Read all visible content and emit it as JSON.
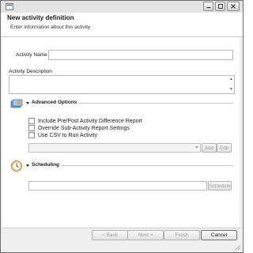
{
  "header": {
    "title": "New activity definition",
    "subtitle": "Enter information about this activity"
  },
  "form": {
    "activity_name_label": "Activity Name :",
    "activity_name_value": "",
    "activity_description_label": "Activity Description",
    "activity_description_value": ""
  },
  "advanced": {
    "title": "Advanced Options",
    "options": [
      {
        "label": "Include Pre/Post Activity Difference Report",
        "checked": false
      },
      {
        "label": "Override Sub-Activity Report Settings",
        "checked": false
      },
      {
        "label": "Use CSV to Run Activity",
        "checked": false
      }
    ],
    "add_label": "Add",
    "edit_label": "Edit"
  },
  "scheduling": {
    "title": "Scheduling",
    "value": "",
    "schedule_label": "Schedule"
  },
  "footer": {
    "back_label": "< Back",
    "next_label": "Next >",
    "finish_label": "Finish",
    "cancel_label": "Cancel"
  },
  "icons": {
    "window": "app-icon",
    "minimize": "minimize-icon",
    "maximize": "maximize-icon",
    "close": "close-icon",
    "advanced": "advanced-options-icon",
    "scheduling": "clock-icon"
  }
}
